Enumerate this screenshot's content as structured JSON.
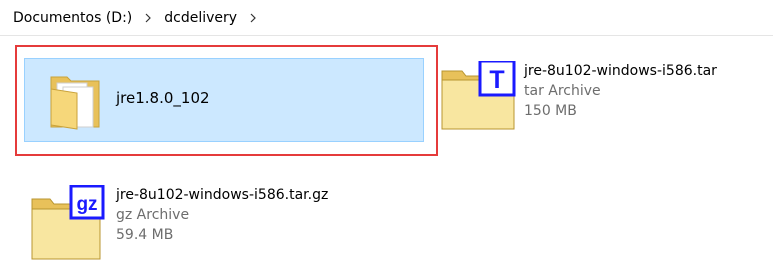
{
  "breadcrumb": {
    "items": [
      "Documentos (D:)",
      "dcdelivery"
    ]
  },
  "files": [
    {
      "name": "jre1.8.0_102",
      "icon": "folder-icon"
    },
    {
      "name": "jre-8u102-windows-i586.tar",
      "type": "tar Archive",
      "size": "150 MB",
      "badge": "T",
      "icon": "tar-archive-icon"
    },
    {
      "name": "jre-8u102-windows-i586.tar.gz",
      "type": "gz Archive",
      "size": "59.4 MB",
      "badge": "gz",
      "icon": "gz-archive-icon"
    }
  ],
  "colors": {
    "selection_bg": "#cce8ff",
    "selection_border": "#99d1ff",
    "highlight": "#e53b3b",
    "badge": "#1a1aff"
  }
}
